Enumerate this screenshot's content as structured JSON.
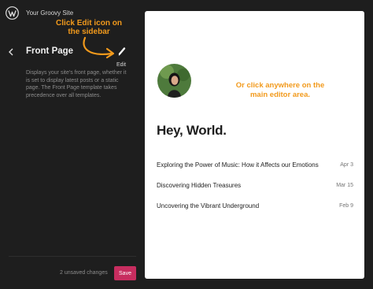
{
  "header": {
    "site_name": "Your Groovy Site"
  },
  "sidebar": {
    "title": "Front Page",
    "edit_label": "Edit",
    "description": "Displays your site's front page, whether it is set to display latest posts or a static page. The Front Page template takes precedence over all templates.",
    "unsaved_changes": "2 unsaved changes",
    "save_label": "Save"
  },
  "annotations": {
    "left": "Click Edit icon on the sidebar",
    "right": "Or click anywhere on the main editor area."
  },
  "canvas": {
    "heading": "Hey, World.",
    "posts": [
      {
        "title": "Exploring the Power of Music: How it Affects our Emotions",
        "date": "Apr 3"
      },
      {
        "title": "Discovering Hidden Treasures",
        "date": "Mar 15"
      },
      {
        "title": "Uncovering the Vibrant Underground",
        "date": "Feb 9"
      }
    ]
  },
  "colors": {
    "sidebar_bg": "#1e1e1e",
    "save_button": "#c72d5f",
    "annotation": "#f29a1c",
    "canvas_bg": "#ffffff"
  },
  "icons": [
    "wordpress-logo",
    "chevron-left-icon",
    "pencil-icon"
  ]
}
